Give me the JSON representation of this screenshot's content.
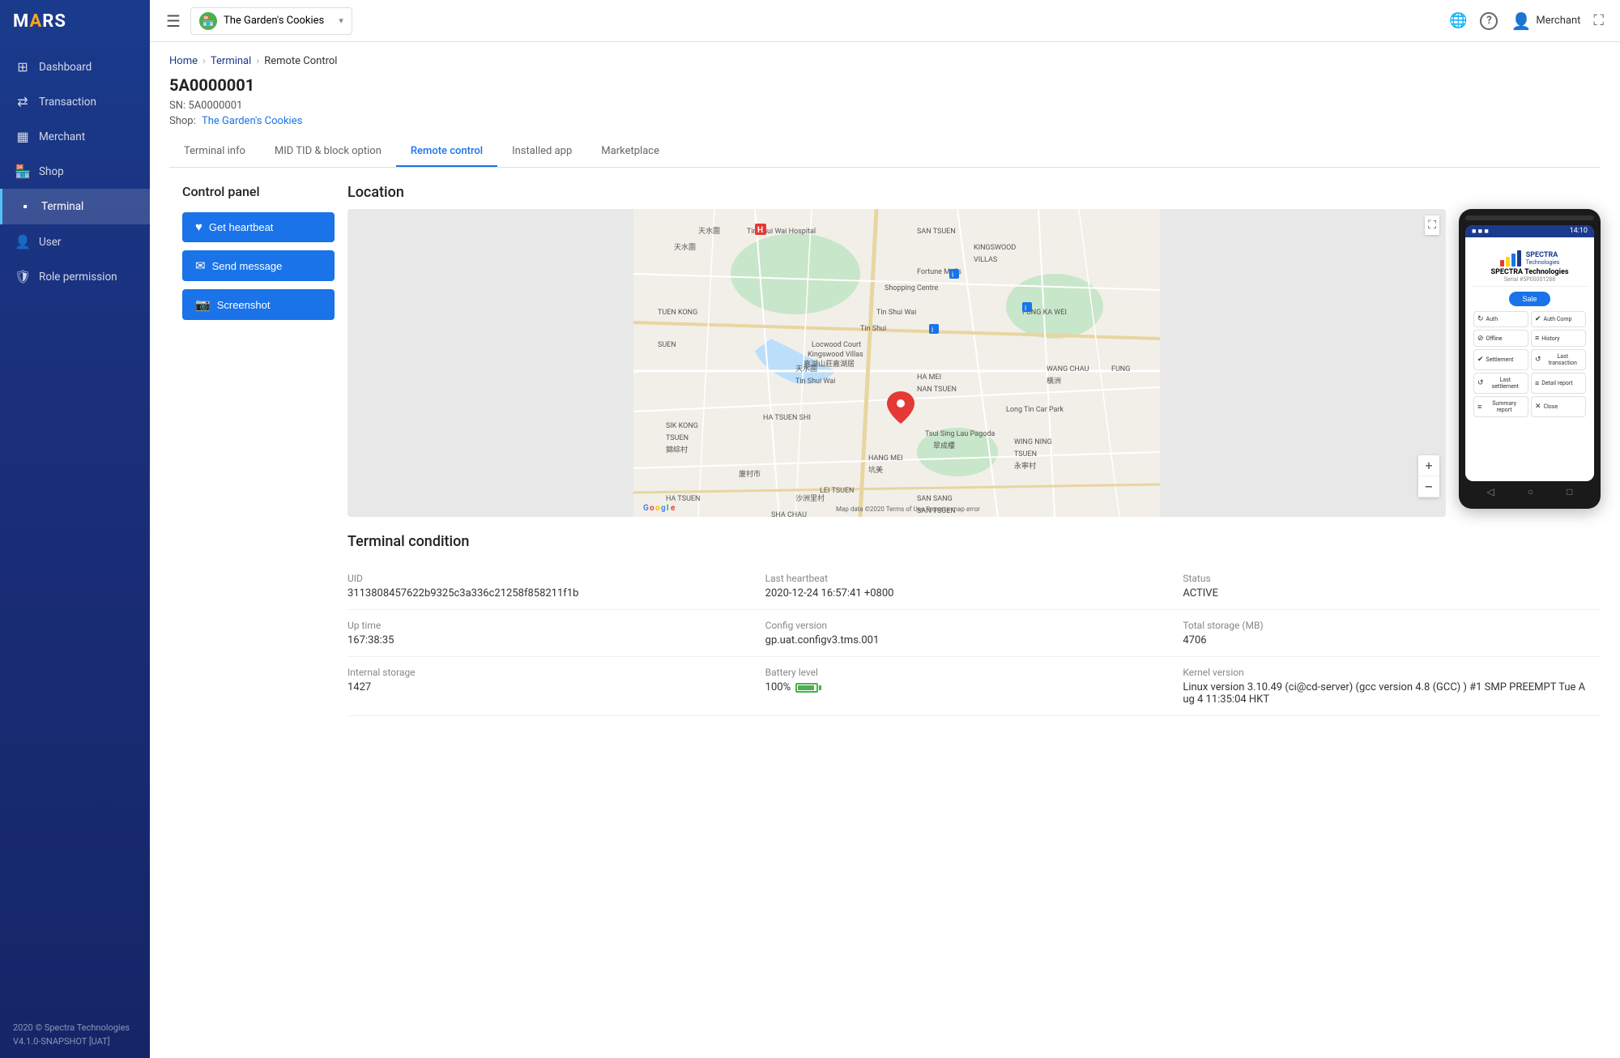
{
  "sidebar": {
    "logo": "MARS",
    "nav_items": [
      {
        "id": "dashboard",
        "label": "Dashboard",
        "icon": "⊞",
        "active": false
      },
      {
        "id": "transaction",
        "label": "Transaction",
        "icon": "↔",
        "active": false
      },
      {
        "id": "merchant",
        "label": "Merchant",
        "icon": "▦",
        "active": false
      },
      {
        "id": "shop",
        "label": "Shop",
        "icon": "🏪",
        "active": false
      },
      {
        "id": "terminal",
        "label": "Terminal",
        "icon": "⬛",
        "active": true
      },
      {
        "id": "user",
        "label": "User",
        "icon": "👤",
        "active": false
      },
      {
        "id": "role-permission",
        "label": "Role permission",
        "icon": "🛡",
        "active": false
      }
    ],
    "footer": "2020 © Spectra Technologies\nV4.1.0-SNAPSHOT [UAT]"
  },
  "topbar": {
    "shop_name": "The Garden's Cookies",
    "user_name": "Merchant",
    "globe_icon": "🌐",
    "help_icon": "?",
    "user_icon": "👤",
    "expand_icon": "⛶"
  },
  "breadcrumb": {
    "home": "Home",
    "terminal": "Terminal",
    "current": "Remote Control"
  },
  "terminal": {
    "id": "5A0000001",
    "sn_label": "SN:",
    "sn": "5A0000001",
    "shop_label": "Shop:",
    "shop_name": "The Garden's Cookies"
  },
  "tabs": [
    {
      "id": "terminal-info",
      "label": "Terminal info",
      "active": false
    },
    {
      "id": "mid-tid",
      "label": "MID TID & block option",
      "active": false
    },
    {
      "id": "remote-control",
      "label": "Remote control",
      "active": true
    },
    {
      "id": "installed-app",
      "label": "Installed app",
      "active": false
    },
    {
      "id": "marketplace",
      "label": "Marketplace",
      "active": false
    }
  ],
  "control_panel": {
    "title": "Control panel",
    "buttons": [
      {
        "id": "get-heartbeat",
        "label": "Get heartbeat",
        "icon": "♥"
      },
      {
        "id": "send-message",
        "label": "Send message",
        "icon": "✉"
      },
      {
        "id": "screenshot",
        "label": "Screenshot",
        "icon": "📷"
      }
    ]
  },
  "location": {
    "title": "Location",
    "credit": "Map data ©2020",
    "terms": "Terms of Use",
    "report": "Report a map error"
  },
  "device": {
    "company": "SPECTRA",
    "company2": "Technologies",
    "full_company": "SPECTRA Technologies",
    "serial": "Serial #5P00001288",
    "sale_btn": "Sale",
    "grid_items": [
      {
        "label": "Auth",
        "icon": "↻"
      },
      {
        "label": "Auth Comp",
        "icon": "✔"
      },
      {
        "label": "Offline",
        "icon": "⊘"
      },
      {
        "label": "History",
        "icon": "≡"
      },
      {
        "label": "Settlement",
        "icon": "✔"
      },
      {
        "label": "Last transaction",
        "icon": "↺"
      },
      {
        "label": "Last settlement",
        "icon": "↺"
      },
      {
        "label": "Detail report",
        "icon": "≡"
      },
      {
        "label": "Summary report",
        "icon": "≡"
      },
      {
        "label": "Close",
        "icon": "✕"
      }
    ],
    "status_time": "14:10"
  },
  "terminal_condition": {
    "title": "Terminal condition",
    "fields": [
      {
        "label": "UID",
        "value": "3113808457622b9325c3a336c21258f858211f1b"
      },
      {
        "label": "Last heartbeat",
        "value": "2020-12-24 16:57:41 +0800"
      },
      {
        "label": "Status",
        "value": "ACTIVE"
      },
      {
        "label": "Up time",
        "value": "167:38:35"
      },
      {
        "label": "Config version",
        "value": "gp.uat.configv3.tms.001"
      },
      {
        "label": "Total storage (MB)",
        "value": "4706"
      },
      {
        "label": "Internal storage",
        "value": "1427"
      },
      {
        "label": "Battery level",
        "value": "100%"
      },
      {
        "label": "Kernel version",
        "value": "Linux version 3.10.49 (ci@cd-server) (gcc version 4.8 (GCC) ) #1 SMP PREEMPT Tue Aug 4 11:35:04 HKT"
      }
    ]
  }
}
